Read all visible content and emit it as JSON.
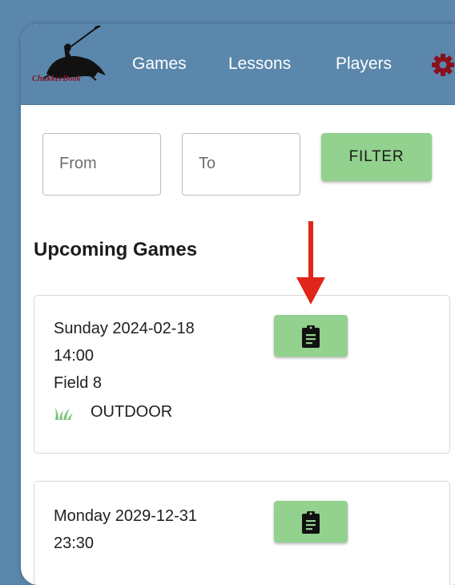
{
  "header": {
    "logo_text": "ChukkerBook",
    "nav": [
      {
        "label": "Games"
      },
      {
        "label": "Lessons"
      },
      {
        "label": "Players"
      }
    ],
    "settings_icon": "gear-icon"
  },
  "filter": {
    "from_placeholder": "From",
    "to_placeholder": "To",
    "button_label": "FILTER"
  },
  "section_title": "Upcoming Games",
  "games": [
    {
      "date": "Sunday 2024-02-18",
      "time": "14:00",
      "field": "Field 8",
      "type": "OUTDOOR",
      "type_icon": "grass-icon",
      "action_icon": "clipboard-icon"
    },
    {
      "date": "Monday 2029-12-31",
      "time": "23:30",
      "action_icon": "clipboard-icon"
    }
  ],
  "colors": {
    "header_bg": "#5a87ab",
    "button_green": "#92d18e",
    "brand_red": "#8a1020",
    "arrow_red": "#e0251b"
  }
}
